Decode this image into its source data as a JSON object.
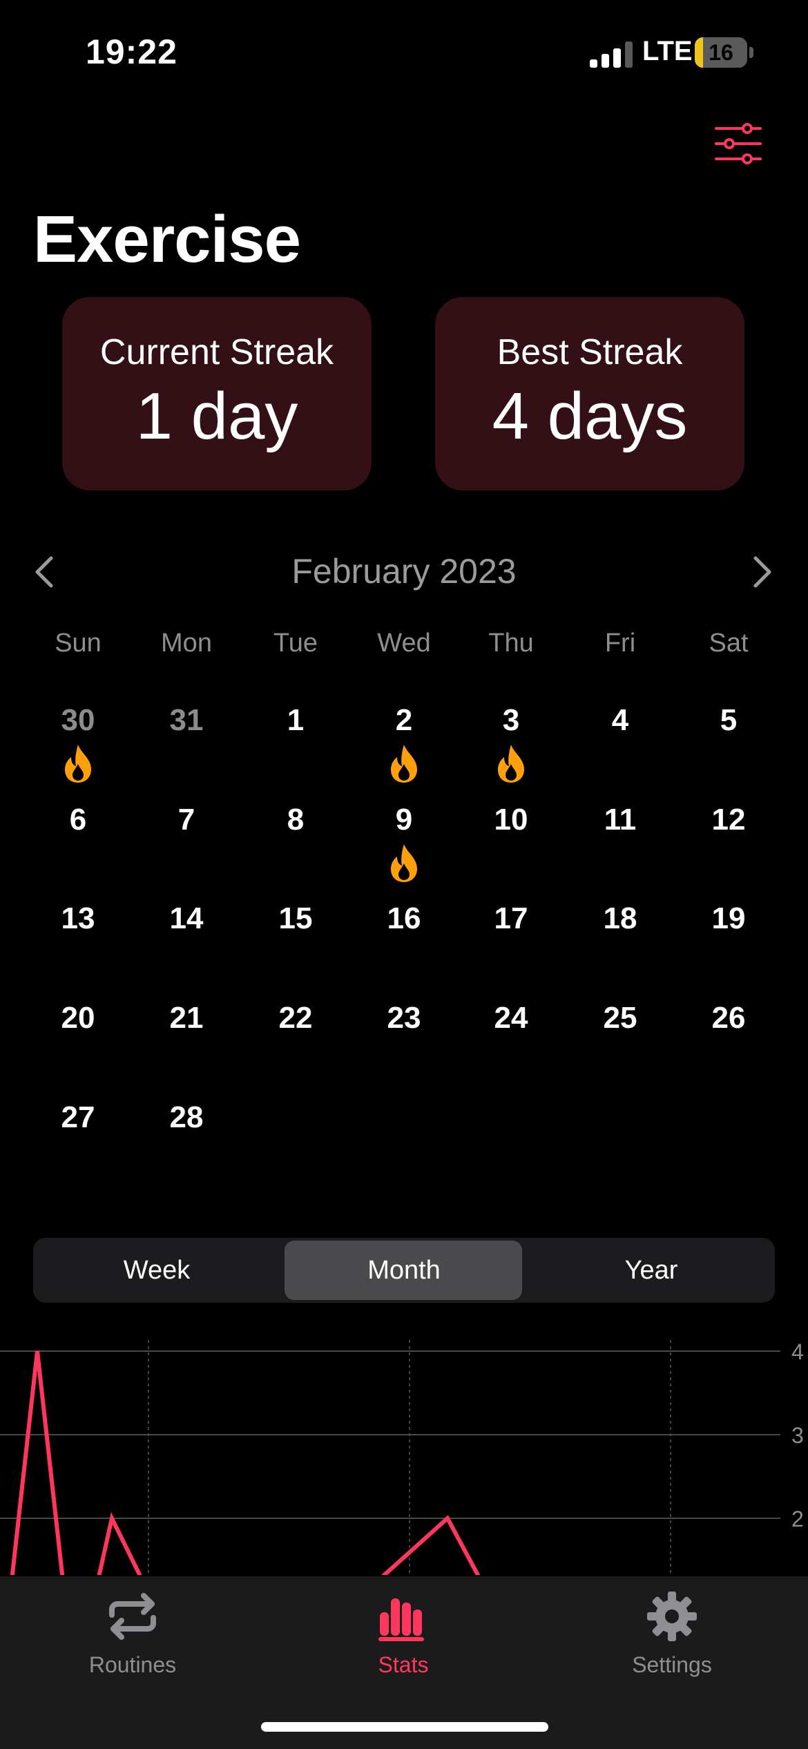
{
  "status_bar": {
    "time": "19:22",
    "network": "LTE",
    "battery": "16",
    "battery_level": 0.16
  },
  "header": {
    "title": "Exercise",
    "filter_icon": "sliders-icon"
  },
  "streaks": {
    "current": {
      "label": "Current Streak",
      "value": "1 day"
    },
    "best": {
      "label": "Best Streak",
      "value": "4 days"
    }
  },
  "calendar": {
    "month_title": "February 2023",
    "weekdays": [
      "Sun",
      "Mon",
      "Tue",
      "Wed",
      "Thu",
      "Fri",
      "Sat"
    ],
    "weeks": [
      [
        {
          "day": "30",
          "muted": true,
          "flame": true
        },
        {
          "day": "31",
          "muted": true
        },
        {
          "day": "1"
        },
        {
          "day": "2",
          "flame": true
        },
        {
          "day": "3",
          "flame": true
        },
        {
          "day": "4"
        },
        {
          "day": "5"
        }
      ],
      [
        {
          "day": "6"
        },
        {
          "day": "7"
        },
        {
          "day": "8"
        },
        {
          "day": "9",
          "flame": true
        },
        {
          "day": "10"
        },
        {
          "day": "11"
        },
        {
          "day": "12"
        }
      ],
      [
        {
          "day": "13"
        },
        {
          "day": "14"
        },
        {
          "day": "15"
        },
        {
          "day": "16"
        },
        {
          "day": "17"
        },
        {
          "day": "18"
        },
        {
          "day": "19"
        }
      ],
      [
        {
          "day": "20"
        },
        {
          "day": "21"
        },
        {
          "day": "22"
        },
        {
          "day": "23"
        },
        {
          "day": "24"
        },
        {
          "day": "25"
        },
        {
          "day": "26"
        }
      ],
      [
        {
          "day": "27"
        },
        {
          "day": "28"
        }
      ]
    ]
  },
  "segments": {
    "options": [
      "Week",
      "Month",
      "Year"
    ],
    "selected": "Month"
  },
  "chart_data": {
    "type": "line",
    "y_tick_labels": [
      "4",
      "3",
      "2"
    ],
    "ylim": [
      0,
      4
    ],
    "grid": true,
    "color": "#ff375f",
    "series": [
      {
        "points": [
          [
            0.0,
            0
          ],
          [
            0.5,
            4
          ],
          [
            1.0,
            0
          ],
          [
            1.5,
            2
          ],
          [
            2.6,
            0
          ],
          [
            3.5,
            0
          ],
          [
            6.0,
            2
          ],
          [
            7.2,
            0
          ]
        ]
      }
    ]
  },
  "tab_bar": {
    "items": [
      {
        "label": "Routines",
        "icon": "repeat-icon"
      },
      {
        "label": "Stats",
        "icon": "bar-chart-icon",
        "active": true
      },
      {
        "label": "Settings",
        "icon": "gear-icon"
      }
    ]
  },
  "colors": {
    "accent": "#ff375f",
    "card_bg": "#331016",
    "flame": "#ff9f0a",
    "tab_inactive": "#8e8e93"
  }
}
